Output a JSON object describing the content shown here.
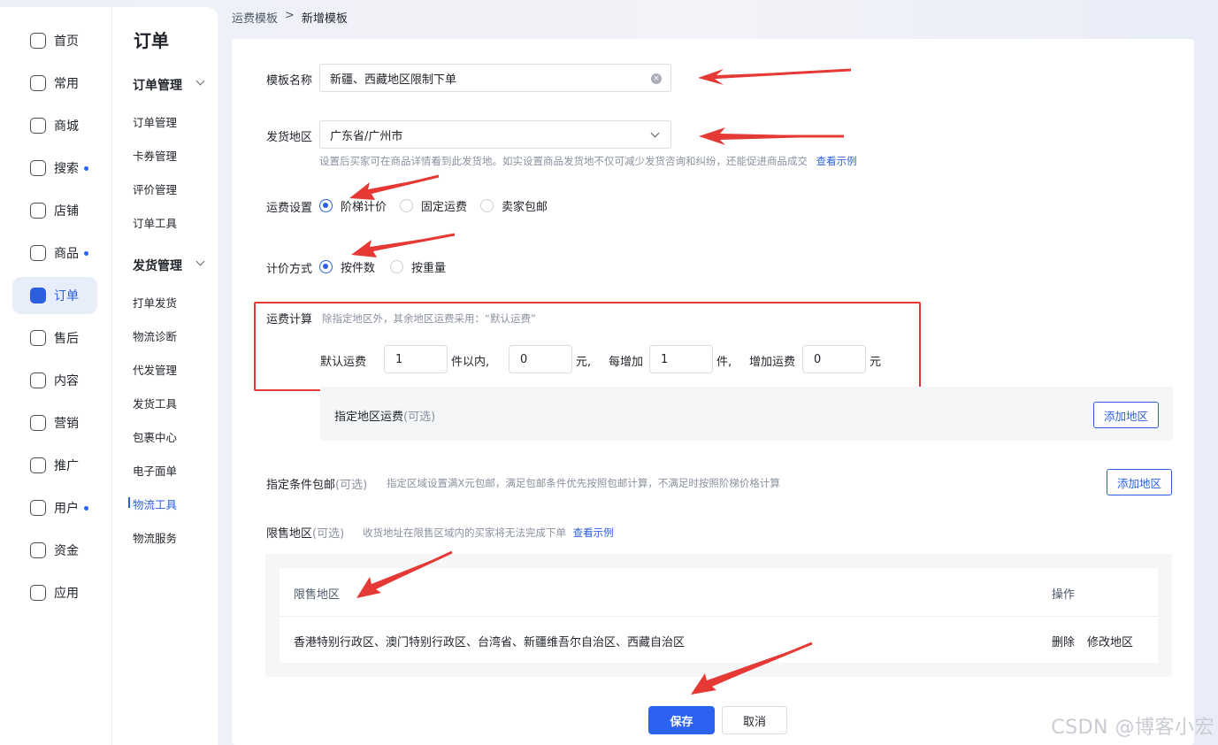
{
  "nav": {
    "items": [
      {
        "label": "首页",
        "icon": "home-icon",
        "dot": false,
        "active": false
      },
      {
        "label": "常用",
        "icon": "folder-icon",
        "dot": false,
        "active": false
      },
      {
        "label": "商城",
        "icon": "store-icon",
        "dot": false,
        "active": false
      },
      {
        "label": "搜索",
        "icon": "search-chart-icon",
        "dot": true,
        "active": false
      },
      {
        "label": "店铺",
        "icon": "shop-icon",
        "dot": false,
        "active": false
      },
      {
        "label": "商品",
        "icon": "bag-icon",
        "dot": true,
        "active": false
      },
      {
        "label": "订单",
        "icon": "order-icon",
        "dot": false,
        "active": true
      },
      {
        "label": "售后",
        "icon": "aftersale-icon",
        "dot": false,
        "active": false
      },
      {
        "label": "内容",
        "icon": "tv-icon",
        "dot": false,
        "active": false
      },
      {
        "label": "营销",
        "icon": "megaphone-icon",
        "dot": false,
        "active": false
      },
      {
        "label": "推广",
        "icon": "send-icon",
        "dot": false,
        "active": false
      },
      {
        "label": "用户",
        "icon": "user-icon",
        "dot": true,
        "active": false
      },
      {
        "label": "资金",
        "icon": "wallet-icon",
        "dot": false,
        "active": false
      },
      {
        "label": "应用",
        "icon": "app-icon",
        "dot": false,
        "active": false
      }
    ]
  },
  "subnav": {
    "title": "订单",
    "group1": "订单管理",
    "group1_items": [
      "订单管理",
      "卡券管理",
      "评价管理",
      "订单工具"
    ],
    "group2": "发货管理",
    "group2_items": [
      "打单发货",
      "物流诊断",
      "代发管理",
      "发货工具",
      "包裹中心",
      "电子面单",
      "物流工具",
      "物流服务"
    ]
  },
  "breadcrumb": {
    "parent": "运费模板",
    "sep": ">",
    "current": "新增模板"
  },
  "form": {
    "name_label": "模板名称",
    "name_value": "新疆、西藏地区限制下单",
    "ship_label": "发货地区",
    "ship_value": "广东省/广州市",
    "ship_hint": "设置后买家可在商品详情看到此发货地。如实设置商品发货地不仅可减少发货咨询和纠纷，还能促进商品成交",
    "ship_hint_link": "查看示例",
    "fee_setting_label": "运费设置",
    "fee_setting_options": [
      "阶梯计价",
      "固定运费",
      "卖家包邮"
    ],
    "pricing_label": "计价方式",
    "pricing_options": [
      "按件数",
      "按重量"
    ],
    "calc_label": "运费计算",
    "calc_hint": "除指定地区外，其余地区运费采用：“默认运费”",
    "default_fee_label": "默认运费",
    "first_count": "1",
    "unit_within": "件以内,",
    "first_price": "0",
    "yuan_comma": "元,",
    "each_add_label": "每增加",
    "add_count": "1",
    "unit_piece": "件,",
    "add_fee_label": "增加运费",
    "add_price": "0",
    "yuan": "元",
    "region_fee_title": "指定地区运费",
    "optional": "(可选)",
    "add_region": "添加地区",
    "free_ship_title": "指定条件包邮",
    "free_ship_hint": "指定区域设置满X元包邮，满足包邮条件优先按照包邮计算，不满足时按照阶梯价格计算",
    "restrict_title": "限售地区",
    "restrict_hint": "收货地址在限售区域内的买家将无法完成下单",
    "restrict_link": "查看示例",
    "table_col1": "限售地区",
    "table_col2": "操作",
    "table_row_regions": "香港特别行政区、澳门特别行政区、台湾省、新疆维吾尔自治区、西藏自治区",
    "row_delete": "删除",
    "row_edit": "修改地区",
    "save": "保存",
    "cancel": "取消"
  },
  "watermark": "CSDN @博客小宏",
  "colors": {
    "primary": "#2b62f0",
    "annotation_red": "#e53935"
  }
}
